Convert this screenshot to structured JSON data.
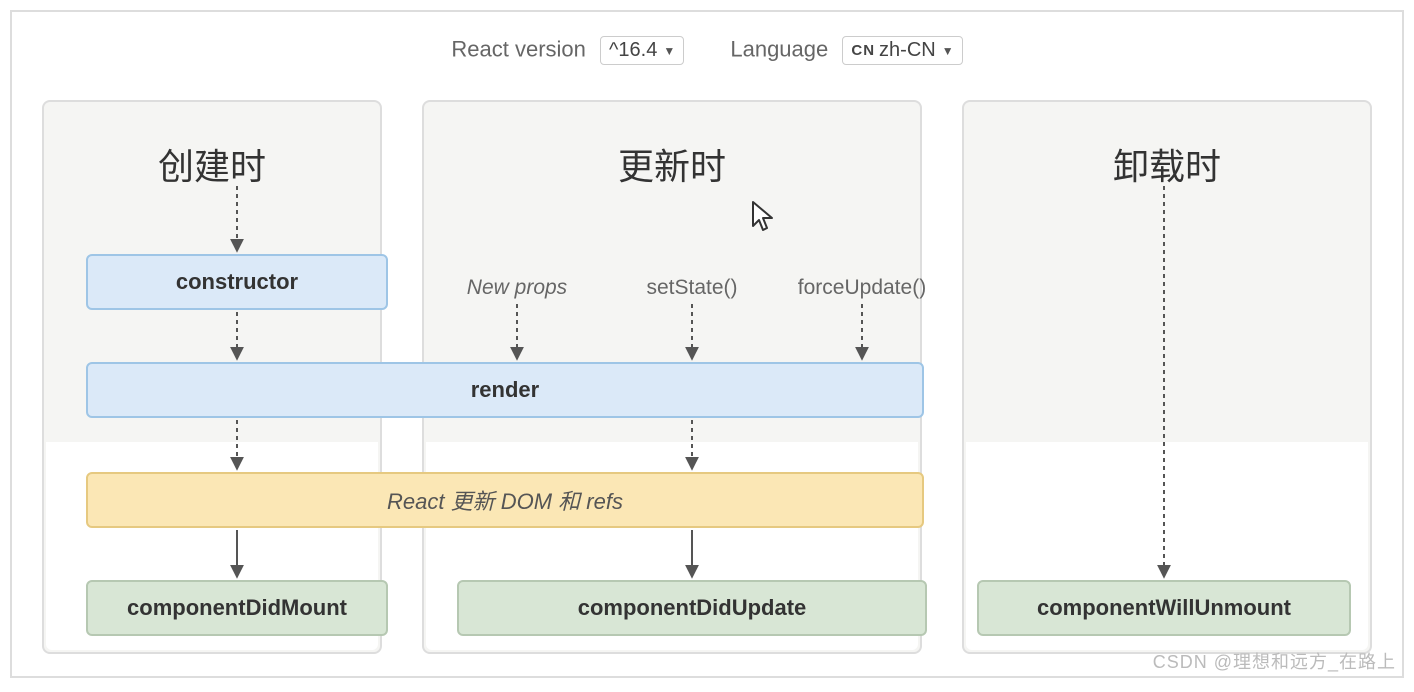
{
  "header": {
    "version_label": "React version",
    "version_value": "^16.4",
    "language_label": "Language",
    "language_prefix": "CN",
    "language_value": "zh-CN"
  },
  "columns": {
    "mount_title": "创建时",
    "update_title": "更新时",
    "unmount_title": "卸载时"
  },
  "triggers": {
    "new_props": "New props",
    "set_state": "setState()",
    "force_update": "forceUpdate()"
  },
  "boxes": {
    "constructor": "constructor",
    "render": "render",
    "dom_update": "React 更新 DOM 和 refs",
    "did_mount": "componentDidMount",
    "did_update": "componentDidUpdate",
    "will_unmount": "componentWillUnmount"
  },
  "watermark": "CSDN @理想和远方_在路上"
}
